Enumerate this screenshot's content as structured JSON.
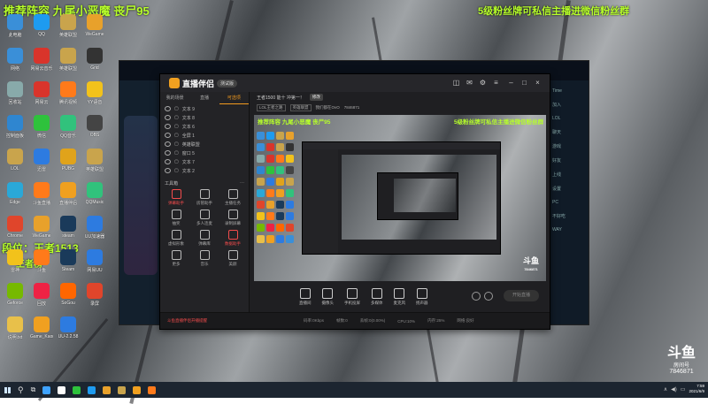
{
  "overlay": {
    "top_left": "推荐阵容  九尾小恶魔  丧尸95",
    "top_right": "5级粉丝牌可私信主播进微信粉丝群",
    "side_rank": "段位：王者1513",
    "side_extra": "王者榜"
  },
  "desktop_icons": [
    {
      "label": "此电脑",
      "color": "#3a8fd8"
    },
    {
      "label": "QQ",
      "color": "#1e9bf0"
    },
    {
      "label": "英雄联盟",
      "color": "#c9a44c"
    },
    {
      "label": "WeGame",
      "color": "#e8a12b"
    },
    {
      "label": "网络",
      "color": "#3a8fd8"
    },
    {
      "label": "网易云音乐",
      "color": "#d9342b"
    },
    {
      "label": "英雄联盟",
      "color": "#c9a44c"
    },
    {
      "label": "Grid",
      "color": "#333"
    },
    {
      "label": "回收站",
      "color": "#8aa"
    },
    {
      "label": "网易云",
      "color": "#d9342b"
    },
    {
      "label": "腾讯视频",
      "color": "#ff7a1a"
    },
    {
      "label": "YY语音",
      "color": "#f2c21b"
    },
    {
      "label": "控制面板",
      "color": "#2f86d0"
    },
    {
      "label": "微信",
      "color": "#2ec23c"
    },
    {
      "label": "QQ音乐",
      "color": "#31c27c"
    },
    {
      "label": "OBS",
      "color": "#444"
    },
    {
      "label": "LOL",
      "color": "#c9a44c"
    },
    {
      "label": "迅雷",
      "color": "#2d7be0"
    },
    {
      "label": "PUBG",
      "color": "#e0a31b"
    },
    {
      "label": "英雄联盟",
      "color": "#c9a44c"
    },
    {
      "label": "Edge",
      "color": "#2aa8d8"
    },
    {
      "label": "斗鱼直播",
      "color": "#ff7a1a"
    },
    {
      "label": "直播伴侣",
      "color": "#f0a020"
    },
    {
      "label": "QQMusic",
      "color": "#31c27c"
    },
    {
      "label": "Chrome",
      "color": "#e0452b"
    },
    {
      "label": "WeGame",
      "color": "#e8a12b"
    },
    {
      "label": "steam",
      "color": "#1a3a5a"
    },
    {
      "label": "UU加速器",
      "color": "#2d7be0"
    },
    {
      "label": "雷神",
      "color": "#f2c21b"
    },
    {
      "label": "斗鱼",
      "color": "#ff7a1a"
    },
    {
      "label": "Steam",
      "color": "#1a3a5a"
    },
    {
      "label": "网易UU",
      "color": "#2d7be0"
    },
    {
      "label": "Geforce",
      "color": "#76b900"
    },
    {
      "label": "回放",
      "color": "#e24"
    },
    {
      "label": "SoGou",
      "color": "#f60"
    },
    {
      "label": "录屏",
      "color": "#e0452b"
    },
    {
      "label": "说明.txt",
      "color": "#e8c04a"
    },
    {
      "label": "Game_Kaori",
      "color": "#f0a020"
    },
    {
      "label": "UU-2.2.58",
      "color": "#2d7be0"
    }
  ],
  "game_right": [
    "Time",
    "加入",
    "LOL",
    "聊天",
    "游戏",
    "好友",
    "上线",
    "设置",
    "PC",
    "不好吃",
    "WAY"
  ],
  "app": {
    "name": "直播伴侣",
    "version_badge": "测试版",
    "side_tabs": [
      "我的场景",
      "直播",
      "可选项"
    ],
    "layers": [
      "文本 9",
      "文本 8",
      "文本 6",
      "全屏 1",
      "英雄联盟",
      "窗口 5",
      "文本 7",
      "文本 2"
    ],
    "toolbox_title": "工具箱",
    "tools": [
      {
        "label": "弹幕助手",
        "hot": true
      },
      {
        "label": "房管助手",
        "hot": false
      },
      {
        "label": "主播任务",
        "hot": false
      },
      {
        "label": "抽奖",
        "hot": false
      },
      {
        "label": "多人连麦",
        "hot": false
      },
      {
        "label": "录制屏幕",
        "hot": false
      },
      {
        "label": "虚拟形象",
        "hot": false
      },
      {
        "label": "弹幕库",
        "hot": false
      },
      {
        "label": "数据助手",
        "hot": true
      },
      {
        "label": "更多",
        "hot": false
      },
      {
        "label": "音乐",
        "hot": false
      },
      {
        "label": "美颜",
        "hot": false
      }
    ],
    "room_title": "王者1500 能十 冲第一！",
    "room_chip": "修改",
    "room_id": "7846871",
    "room_tags": [
      "LOL王者之路",
      "英雄联盟",
      "我们都在OvO"
    ],
    "preview_texts": {
      "left": "推荐阵容  九尾小恶魔  丧尸95",
      "right": "5级粉丝牌可私信主播进微信粉丝群"
    },
    "watermark_brand": "斗鱼",
    "watermark_room": "7846871",
    "actions": [
      "直播间",
      "摄像头",
      "手机投屏",
      "多媒体",
      "麦克风",
      "扬声器"
    ],
    "start_label": "开始直播",
    "status": {
      "notice": "斗鱼直播伴侣开播提醒",
      "items": [
        "码率:0Kbps",
        "帧数:0",
        "丢帧:0(0.00%)",
        "CPU:10%",
        "内存:25%",
        "网络:良好"
      ]
    }
  },
  "bottom_watermark": {
    "brand": "斗鱼",
    "sub": "房间号",
    "id": "7846871"
  },
  "clock": {
    "time": "7:59",
    "date": "2021/6/9"
  },
  "taskbar_apps": [
    "#3fa3ff",
    "#ffffff",
    "#2ec23c",
    "#1e9bf0",
    "#e8a12b",
    "#c9a44c",
    "#f0a020",
    "#ff7a1a"
  ]
}
